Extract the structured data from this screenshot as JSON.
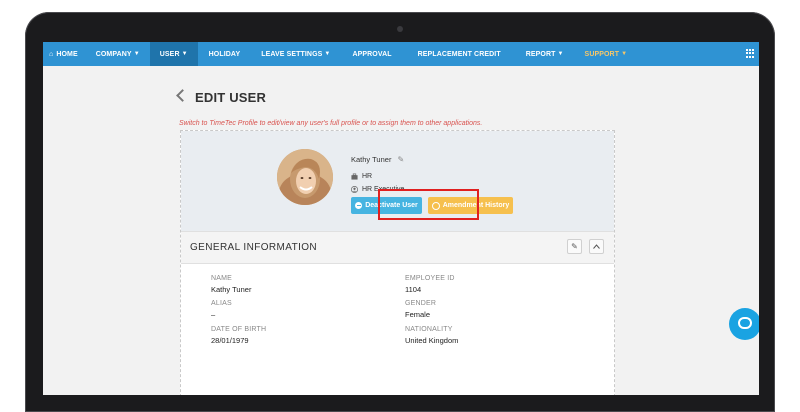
{
  "nav": {
    "items": [
      {
        "label": "HOME",
        "caret": false
      },
      {
        "label": "COMPANY",
        "caret": true
      },
      {
        "label": "USER",
        "caret": true
      },
      {
        "label": "HOLIDAY",
        "caret": false
      },
      {
        "label": "LEAVE SETTINGS",
        "caret": true
      },
      {
        "label": "APPROVAL",
        "caret": false
      },
      {
        "label": "REPLACEMENT CREDIT",
        "caret": false
      },
      {
        "label": "REPORT",
        "caret": true
      },
      {
        "label": "SUPPORT",
        "caret": true
      }
    ],
    "active": "USER",
    "bg_color": "#2f93d3",
    "active_color": "#1f74ab",
    "support_color": "#f5c76a"
  },
  "page": {
    "title": "EDIT USER",
    "notice": "Switch to TimeTec Profile to edit/view any user's full profile or to assign them to other applications."
  },
  "profile": {
    "name": "Kathy Tuner",
    "department": "HR",
    "position": "HR Executive",
    "deactivate_label": "Deactivate User",
    "amendment_label": "Amendment History"
  },
  "general_info": {
    "title": "GENERAL INFORMATION",
    "fields": {
      "name_label": "NAME",
      "name_value": "Kathy Tuner",
      "employee_id_label": "EMPLOYEE ID",
      "employee_id_value": "1104",
      "alias_label": "ALIAS",
      "alias_value": "–",
      "gender_label": "GENDER",
      "gender_value": "Female",
      "dob_label": "DATE OF BIRTH",
      "dob_value": "28/01/1979",
      "nationality_label": "NATIONALITY",
      "nationality_value": "United Kingdom"
    }
  },
  "colors": {
    "deactivate": "#46b4e1",
    "amendment": "#f6c04e",
    "highlight": "#e02020",
    "notice": "#d9534f",
    "chat": "#1aa3e2"
  },
  "icons": [
    "home-icon",
    "caret-down-icon",
    "apps-grid-icon",
    "back-chevron-icon",
    "pencil-icon",
    "briefcase-icon",
    "user-circle-icon",
    "minus-circle-icon",
    "clock-icon",
    "chevron-up-icon",
    "chat-icon"
  ]
}
